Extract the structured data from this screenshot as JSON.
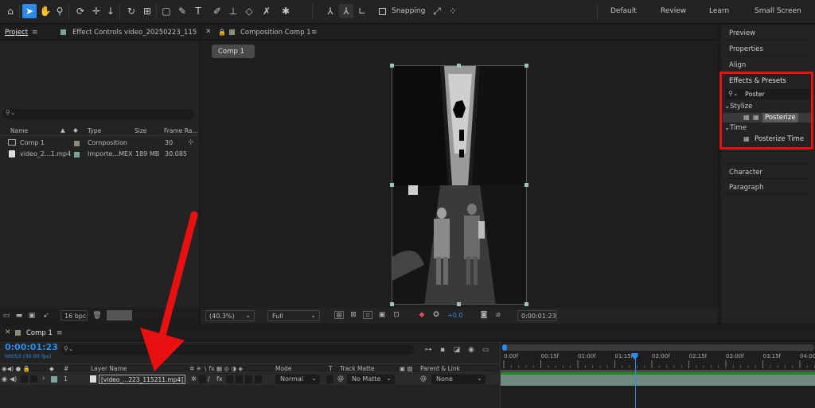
{
  "toolbar": {
    "snapping_label": "Snapping",
    "workspaces": [
      "Default",
      "Review",
      "Learn",
      "Small Screen"
    ]
  },
  "project_panel": {
    "tab_project": "Project",
    "tab_effect_controls": "Effect Controls video_20250223_115",
    "columns": [
      "Name",
      "Type",
      "Size",
      "Frame Ra..."
    ],
    "rows": [
      {
        "name": "Comp 1",
        "type": "Composition",
        "size": "",
        "fps": "30"
      },
      {
        "name": "video_2...1.mp4",
        "type": "Importe...MEX",
        "size": "189 MB",
        "fps": "30.085"
      }
    ],
    "bpc": "16 bpc"
  },
  "composition_panel": {
    "tab_label": "Composition Comp 1",
    "comp_button": "Comp 1",
    "zoom": "(40.3%)",
    "resolution": "Full",
    "exposure": "+0.0",
    "timecode": "0:00:01:23"
  },
  "right_panel": {
    "items_top": [
      "Preview",
      "Properties",
      "Align"
    ],
    "effects_title": "Effects & Presets",
    "search_value": "Poster",
    "groups": [
      {
        "name": "Stylize",
        "effect": "Posterize"
      },
      {
        "name": "Time",
        "effect": "Posterize Time"
      }
    ],
    "items_bottom": [
      "Character",
      "Paragraph"
    ]
  },
  "timeline": {
    "tab_label": "Comp 1",
    "timecode": "0:00:01:23",
    "frame_info": "00053 (30.00 fps)",
    "col_layer_name": "Layer Name",
    "col_mode": "Mode",
    "col_t": "T",
    "col_track_matte": "Track Matte",
    "col_parent": "Parent & Link",
    "layer": {
      "number": "1",
      "name": "[video_...223_115211.mp4]",
      "mode": "Normal",
      "matte": "No Matte",
      "parent": "None"
    },
    "ruler": [
      "0:00f",
      "00:15f",
      "01:00f",
      "01:15f",
      "02:00f",
      "02:15f",
      "03:00f",
      "03:15f",
      "04:00f"
    ],
    "playhead_seconds": 1.77
  },
  "colors": {
    "accent": "#2d8ceb",
    "highlight": "#e81010",
    "label_gray": "#8c8c7a",
    "label_teal": "#7aa39a"
  }
}
